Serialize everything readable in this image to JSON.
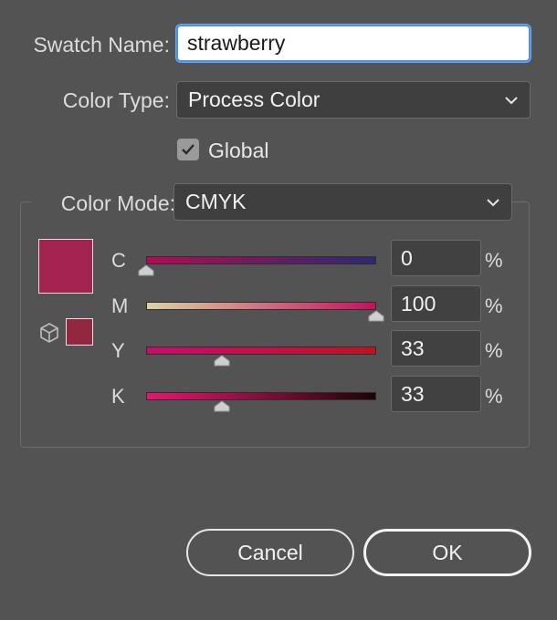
{
  "swatch_name": {
    "label": "Swatch Name:",
    "value": "strawberry"
  },
  "color_type": {
    "label": "Color Type:",
    "selected": "Process Color",
    "icon": "chevron-down-icon"
  },
  "global": {
    "label": "Global",
    "checked": true,
    "icon": "checkmark-icon"
  },
  "color_mode": {
    "label": "Color Mode:",
    "selected": "CMYK",
    "icon": "chevron-down-icon"
  },
  "preview": {
    "swatch_color": "#a3224f",
    "out_of_gamut_color": "#92273f",
    "gamut_icon": "cube-icon"
  },
  "channels": [
    {
      "letter": "C",
      "value": "0",
      "percent": 0,
      "unit": "%",
      "gradient": [
        "#b30a55",
        "#2c2a6e"
      ]
    },
    {
      "letter": "M",
      "value": "100",
      "percent": 100,
      "unit": "%",
      "gradient": [
        "#d9d3a3",
        "#c8105e"
      ]
    },
    {
      "letter": "Y",
      "value": "33",
      "percent": 33,
      "unit": "%",
      "gradient": [
        "#c70d6e",
        "#c21220"
      ]
    },
    {
      "letter": "K",
      "value": "33",
      "percent": 33,
      "unit": "%",
      "gradient": [
        "#ea1571",
        "#1c0505"
      ]
    }
  ],
  "buttons": {
    "cancel": "Cancel",
    "ok": "OK"
  },
  "colors": {
    "dialog_bg": "#535353",
    "focus_ring": "#4b8fe6"
  }
}
